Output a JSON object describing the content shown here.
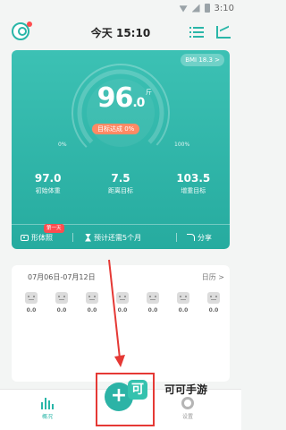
{
  "status_bar": {
    "time": "3:10"
  },
  "header": {
    "title": "今天 15:10"
  },
  "card": {
    "bmi": "BMI 18.3 >",
    "weight_int": "96",
    "weight_dec": ".0",
    "unit": "斤",
    "goal_badge": "目标达成 0%",
    "progress_percent": 0,
    "pct_left": "0%",
    "pct_right": "100%",
    "stats": [
      {
        "value": "97.0",
        "label": "初始体重"
      },
      {
        "value": "7.5",
        "label": "距离目标"
      },
      {
        "value": "103.5",
        "label": "增重目标"
      }
    ],
    "actions": {
      "body_shape": "形体照",
      "first_day_badge": "第一天",
      "estimate": "预计还需5个月",
      "share": "分享"
    }
  },
  "week": {
    "range": "07月06日-07月12日",
    "calendar": "日历 >",
    "days": [
      {
        "value": "0.0"
      },
      {
        "value": "0.0"
      },
      {
        "value": "0.0"
      },
      {
        "value": "0.0"
      },
      {
        "value": "0.0"
      },
      {
        "value": "0.0"
      },
      {
        "value": "0.0"
      }
    ]
  },
  "bottom_nav": {
    "overview": "概况",
    "add": "+",
    "settings": "设置"
  },
  "watermark": {
    "logo": "可",
    "text": "可可手游"
  },
  "colors": {
    "accent": "#29b6a8",
    "highlight": "#e53935",
    "badge": "#ff8a65"
  }
}
